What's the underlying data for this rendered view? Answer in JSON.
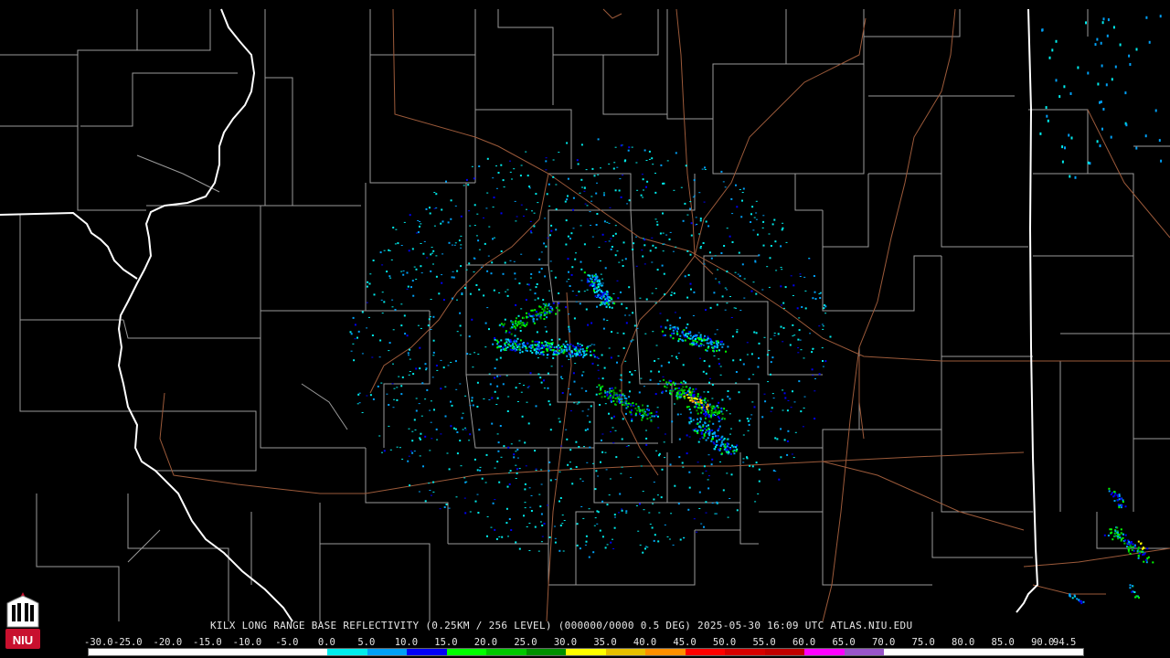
{
  "map": {
    "caption": "KILX LONG RANGE BASE REFLECTIVITY (0.25KM / 256 LEVEL) (000000/0000 0.5 DEG) 2025-05-30 16:09 UTC  ATLAS.NIU.EDU",
    "background_color": "#000000",
    "border_colors": {
      "state": "#ffffff",
      "county": "#9a9a9a",
      "highway": "#9c5a3a"
    }
  },
  "scale": {
    "labels": [
      "-30.0",
      "-25.0",
      "-20.0",
      "-15.0",
      "-10.0",
      "-5.0",
      "0.0",
      "5.0",
      "10.0",
      "15.0",
      "20.0",
      "25.0",
      "30.0",
      "35.0",
      "40.0",
      "45.0",
      "50.0",
      "55.0",
      "60.0",
      "65.0",
      "70.0",
      "75.0",
      "80.0",
      "85.0",
      "90.0",
      "94.5"
    ],
    "colors": [
      "#ffffff",
      "#ffffff",
      "#ffffff",
      "#ffffff",
      "#ffffff",
      "#ffffff",
      "#00ecec",
      "#01a0f6",
      "#0000f6",
      "#00ff00",
      "#00c800",
      "#009000",
      "#ffff00",
      "#e7c000",
      "#ff9000",
      "#ff0000",
      "#d60000",
      "#c00000",
      "#ff00ff",
      "#9955c9",
      "#ffffff",
      "#ffffff",
      "#ffffff",
      "#ffffff",
      "#ffffff"
    ]
  },
  "logo": {
    "text": "NIU",
    "icon": "niu-tower-icon"
  }
}
